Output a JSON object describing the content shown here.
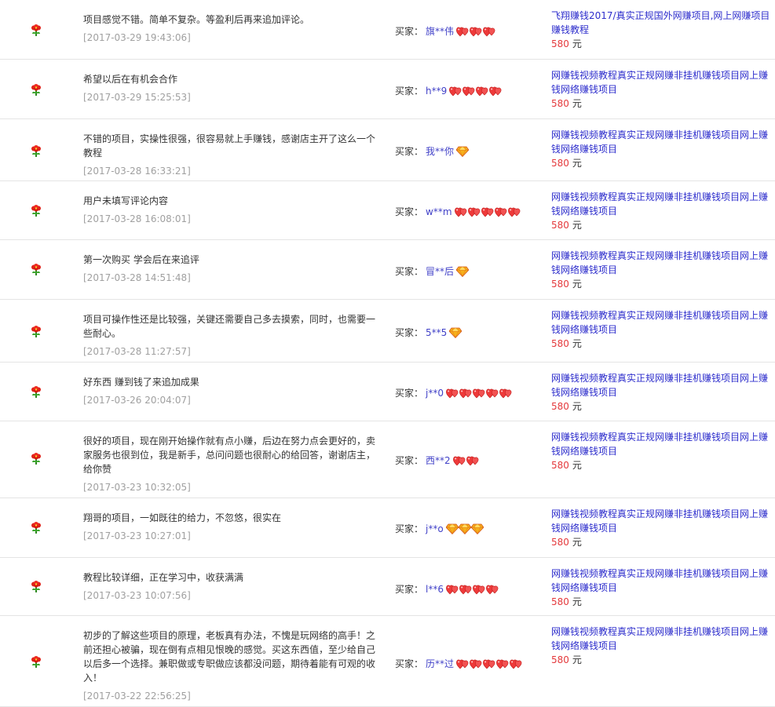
{
  "labels": {
    "buyer": "买家：",
    "currency": "元"
  },
  "reviews": [
    {
      "text": "项目感觉不错。简单不复杂。等盈利后再来追加评论。",
      "date": "[2017-03-29 19:43:06]",
      "buyer": "旗**伟",
      "level_icon": "red-heart",
      "level_count": 3,
      "item_title": "飞翔赚钱2017/真实正规国外网赚项目,网上网赚项目赚钱教程",
      "price": "580"
    },
    {
      "text": "希望以后在有机会合作",
      "date": "[2017-03-29 15:25:53]",
      "buyer": "h**9",
      "level_icon": "red-heart",
      "level_count": 4,
      "item_title": "网赚钱视频教程真实正规网赚非挂机赚钱项目网上赚钱网络赚钱项目",
      "price": "580"
    },
    {
      "text": "不错的项目，实操性很强，很容易就上手赚钱，感谢店主开了这么一个教程",
      "date": "[2017-03-28 16:33:21]",
      "buyer": "我**你",
      "level_icon": "blue-diamond",
      "level_count": 1,
      "item_title": "网赚钱视频教程真实正规网赚非挂机赚钱项目网上赚钱网络赚钱项目",
      "price": "580"
    },
    {
      "text": "用户未填写评论内容",
      "date": "[2017-03-28 16:08:01]",
      "buyer": "w**m",
      "level_icon": "red-heart",
      "level_count": 5,
      "item_title": "网赚钱视频教程真实正规网赚非挂机赚钱项目网上赚钱网络赚钱项目",
      "price": "580"
    },
    {
      "text": "第一次购买 学会后在来追评",
      "date": "[2017-03-28 14:51:48]",
      "buyer": "冒**后",
      "level_icon": "blue-diamond",
      "level_count": 1,
      "item_title": "网赚钱视频教程真实正规网赚非挂机赚钱项目网上赚钱网络赚钱项目",
      "price": "580"
    },
    {
      "text": "项目可操作性还是比较强，关键还需要自己多去摸索，同时，也需要一些耐心。",
      "date": "[2017-03-28 11:27:57]",
      "buyer": "5**5",
      "level_icon": "blue-diamond",
      "level_count": 1,
      "item_title": "网赚钱视频教程真实正规网赚非挂机赚钱项目网上赚钱网络赚钱项目",
      "price": "580"
    },
    {
      "text": "好东西 赚到钱了来追加成果",
      "date": "[2017-03-26 20:04:07]",
      "buyer": "j**0",
      "level_icon": "red-heart",
      "level_count": 5,
      "item_title": "网赚钱视频教程真实正规网赚非挂机赚钱项目网上赚钱网络赚钱项目",
      "price": "580"
    },
    {
      "text": "很好的项目，现在刚开始操作就有点小赚，后边在努力点会更好的，卖家服务也很到位，我是新手，总问问题也很耐心的给回答，谢谢店主，给你赞",
      "date": "[2017-03-23 10:32:05]",
      "buyer": "西**2",
      "level_icon": "red-heart",
      "level_count": 2,
      "item_title": "网赚钱视频教程真实正规网赚非挂机赚钱项目网上赚钱网络赚钱项目",
      "price": "580"
    },
    {
      "text": "翔哥的项目，一如既往的给力，不忽悠，很实在",
      "date": "[2017-03-23 10:27:01]",
      "buyer": "j**o",
      "level_icon": "blue-diamond",
      "level_count": 3,
      "item_title": "网赚钱视频教程真实正规网赚非挂机赚钱项目网上赚钱网络赚钱项目",
      "price": "580"
    },
    {
      "text": "教程比较详细，正在学习中，收获满满",
      "date": "[2017-03-23 10:07:56]",
      "buyer": "l**6",
      "level_icon": "red-heart",
      "level_count": 4,
      "item_title": "网赚钱视频教程真实正规网赚非挂机赚钱项目网上赚钱网络赚钱项目",
      "price": "580"
    },
    {
      "text": "初步的了解这些项目的原理，老板真有办法，不愧是玩网络的高手！之前还担心被骗，现在倒有点相见恨晚的感觉。买这东西值，至少给自己以后多一个选择。兼职做或专职做应该都没问题，期待着能有可观的收入！",
      "date": "[2017-03-22 22:56:25]",
      "buyer": "历**过",
      "level_icon": "red-heart",
      "level_count": 5,
      "item_title": "网赚钱视频教程真实正规网赚非挂机赚钱项目网上赚钱网络赚钱项目",
      "price": "580"
    }
  ]
}
